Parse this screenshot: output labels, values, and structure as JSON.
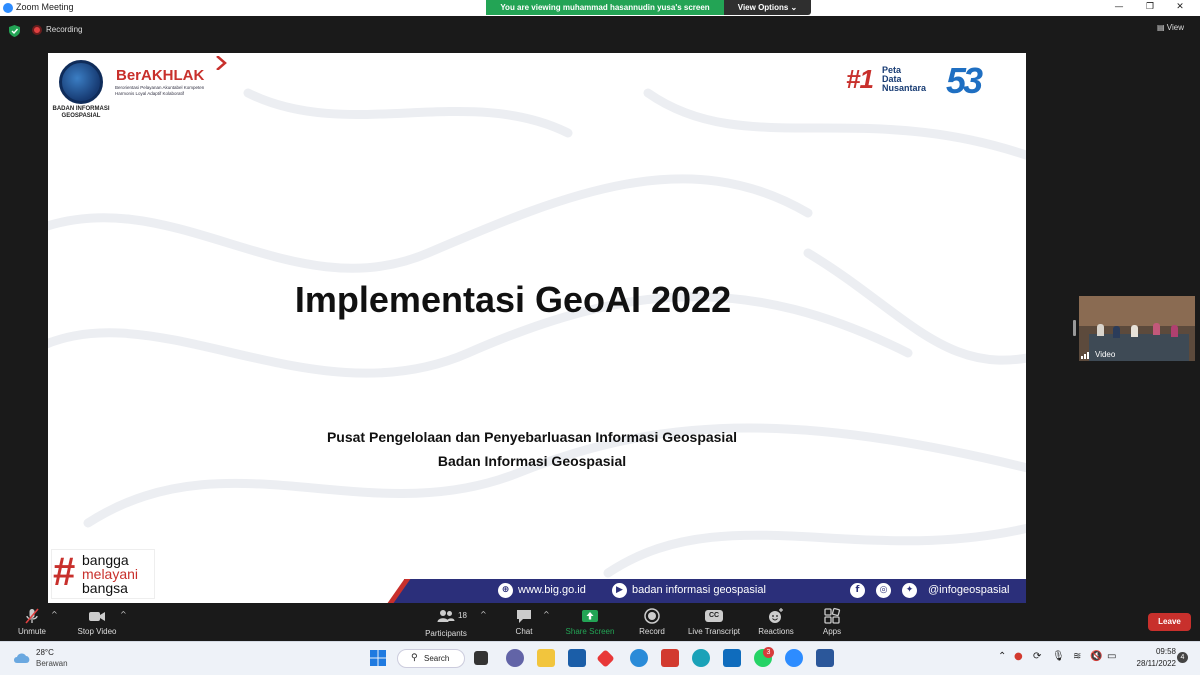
{
  "window": {
    "title": "Zoom Meeting",
    "viewing_banner": "You are viewing muhammad hasannudin yusa's screen",
    "view_options": "View Options ⌄",
    "controls": {
      "minimize": "—",
      "restore": "❐",
      "close": "✕"
    }
  },
  "meeting": {
    "recording_label": "Recording",
    "view_label": "View"
  },
  "slide": {
    "org_logo_text": "BADAN INFORMASI GEOSPASIAL",
    "berakhlak": "BerAKHLAK",
    "berakhlak_sub1": "Berorientasi Pelayanan Akuntabel Kompeten",
    "berakhlak_sub2": "Harmonis Loyal Adaptif Kolaboratif",
    "peta_hash": "#1",
    "peta_line1": "Peta",
    "peta_line2": "Data",
    "peta_line3": "Nusantara",
    "anniversary": "53",
    "title": "Implementasi GeoAI 2022",
    "subtitle1": "Pusat Pengelolaan dan Penyebarluasan Informasi Geospasial",
    "subtitle2": "Badan Informasi Geospasial",
    "bangga_hash": "#",
    "bangga_line1": "bangga",
    "bangga_line2": "melayani",
    "bangga_line3": "bangsa",
    "footer_web": "www.big.go.id",
    "footer_youtube": "badan informasi geospasial",
    "footer_social": "@infogeospasial"
  },
  "video_thumb": {
    "label": "Video"
  },
  "toolbar": {
    "unmute": "Unmute",
    "stop_video": "Stop Video",
    "participants": "Participants",
    "participants_count": "18",
    "chat": "Chat",
    "share_screen": "Share Screen",
    "record": "Record",
    "live_transcript": "Live Transcript",
    "transcript_icon_text": "CC",
    "reactions": "Reactions",
    "apps": "Apps",
    "leave": "Leave",
    "caret": "^"
  },
  "taskbar": {
    "weather_temp": "28°C",
    "weather_desc": "Berawan",
    "search": "Search",
    "whatsapp_badge": "3",
    "time": "09:58",
    "date": "28/11/2022",
    "notifications": "4"
  },
  "colors": {
    "zoom_green": "#23a455",
    "leave_red": "#c8302c",
    "footer_navy": "#2b2f7a",
    "brand_red": "#c8302c"
  }
}
